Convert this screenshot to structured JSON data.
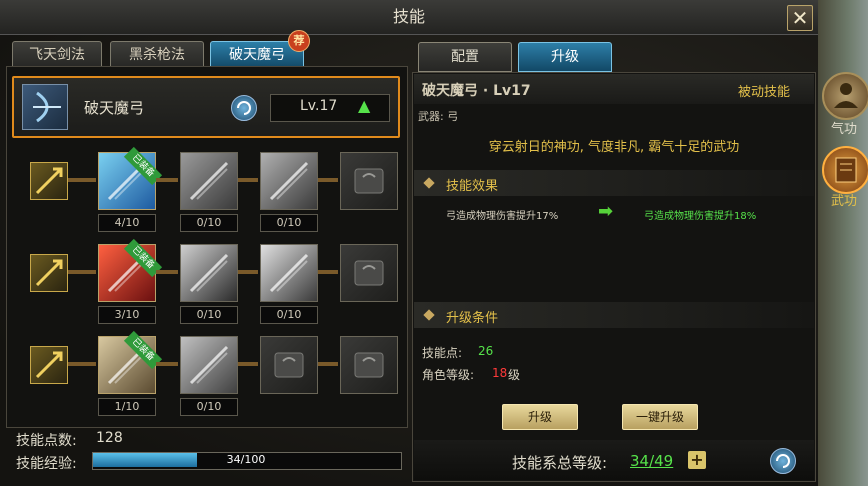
{
  "window": {
    "title": "技能",
    "close_icon": "close-icon"
  },
  "left_tabs": [
    {
      "label": "飞天剑法",
      "active": false
    },
    {
      "label": "黑杀枪法",
      "active": false
    },
    {
      "label": "破天魔弓",
      "active": true,
      "badge": "荐"
    }
  ],
  "header": {
    "skill_name": "破天魔弓",
    "level": "Lv.17",
    "refresh_icon": "refresh-icon",
    "level_up_icon": "arrow-up-icon"
  },
  "tree": {
    "rows": [
      {
        "row_icon": "arrow-strike-icon",
        "nodes": [
          {
            "icon": "bow-shot-skill-icon",
            "count": "4/10",
            "equipped": true,
            "ribbon": "已装备"
          },
          {
            "icon": "arrow-volley-skill-icon",
            "count": "0/10"
          },
          {
            "icon": "claw-slash-skill-icon",
            "count": "0/10"
          },
          {
            "icon": "locked-skill-icon"
          }
        ]
      },
      {
        "row_icon": "multi-arrow-icon",
        "nodes": [
          {
            "icon": "fire-arrow-skill-icon",
            "count": "3/10",
            "equipped": true,
            "ribbon": "已装备"
          },
          {
            "icon": "wind-slash-skill-icon",
            "count": "0/10"
          },
          {
            "icon": "light-beam-skill-icon",
            "count": "0/10"
          },
          {
            "icon": "locked-skill-icon"
          }
        ]
      },
      {
        "row_icon": "bow-icon",
        "nodes": [
          {
            "icon": "eagle-skill-icon",
            "count": "1/10",
            "equipped": true,
            "ribbon": "已装备"
          },
          {
            "icon": "falcon-skill-icon",
            "count": "0/10"
          },
          {
            "icon": "locked-skill-icon"
          },
          {
            "icon": "locked-skill-icon"
          }
        ]
      }
    ]
  },
  "footer": {
    "points_label": "技能点数:",
    "points_value": "128",
    "exp_label": "技能经验:",
    "exp_text": "34/100",
    "exp_fraction": 0.34
  },
  "right_tabs": [
    {
      "label": "配置",
      "active": false
    },
    {
      "label": "升级",
      "active": true
    }
  ],
  "detail": {
    "title": "破天魔弓 · Lv17",
    "type": "被动技能",
    "weapon": "武器: 弓",
    "description": "穿云射日的神功, 气度非凡, 霸气十足的武功",
    "effect_section": "技能效果",
    "effect_current": "弓造成物理伤害提升17%",
    "effect_next": "弓造成物理伤害提升18%",
    "req_section": "升级条件",
    "req_points_label": "技能点:",
    "req_points_value": "26",
    "req_level_label": "角色等级:",
    "req_level_value": "18",
    "req_level_suffix": "级",
    "upgrade_button": "升级",
    "oneclick_button": "一键升级"
  },
  "total": {
    "label": "技能系总等级:",
    "value": "34/49"
  },
  "side": [
    {
      "label": "气功",
      "icon": "meditation-icon"
    },
    {
      "label": "武功",
      "icon": "scroll-book-icon"
    }
  ],
  "colors": {
    "accent_orange": "#e08a1c",
    "tab_active": "#1e6e9e",
    "green": "#56e24a",
    "gold": "#e3c04a",
    "red": "#ff3a3a"
  }
}
